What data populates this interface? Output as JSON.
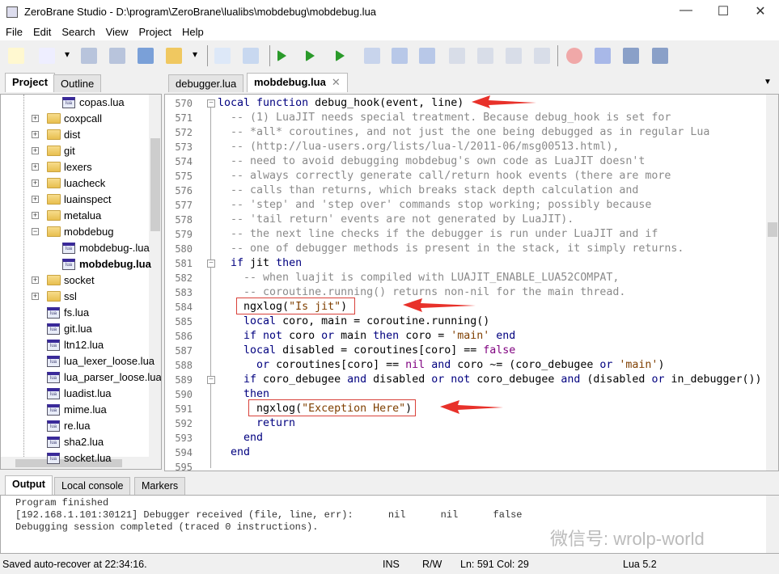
{
  "window": {
    "title": "ZeroBrane Studio - D:\\program\\ZeroBrane\\lualibs\\mobdebug\\mobdebug.lua",
    "minimize": "—",
    "maximize": "☐",
    "close": "✕"
  },
  "menu": [
    "File",
    "Edit",
    "Search",
    "View",
    "Project",
    "Help"
  ],
  "toolbar": [
    "new-file",
    "open-file",
    "save",
    "save-all",
    "project-directory",
    "choose-project-directory",
    "find",
    "find-in-files",
    "start-debugging",
    "run",
    "run-as-scratchpad",
    "stop",
    "continue",
    "pause",
    "step-into",
    "step-over",
    "step-out",
    "run-to-cursor",
    "toggle-breakpoint",
    "toggle-bookmark",
    "stack-window",
    "watch-window"
  ],
  "left_tabs": [
    "Project",
    "Outline"
  ],
  "tree": [
    {
      "label": "copas.lua",
      "type": "file",
      "level": 2
    },
    {
      "label": "coxpcall",
      "type": "folder"
    },
    {
      "label": "dist",
      "type": "folder"
    },
    {
      "label": "git",
      "type": "folder"
    },
    {
      "label": "lexers",
      "type": "folder"
    },
    {
      "label": "luacheck",
      "type": "folder"
    },
    {
      "label": "luainspect",
      "type": "folder"
    },
    {
      "label": "metalua",
      "type": "folder"
    },
    {
      "label": "mobdebug",
      "type": "folder",
      "expanded": true
    },
    {
      "label": "mobdebug-.lua",
      "type": "file",
      "level": 2
    },
    {
      "label": "mobdebug.lua",
      "type": "file",
      "level": 2,
      "bold": true
    },
    {
      "label": "socket",
      "type": "folder"
    },
    {
      "label": "ssl",
      "type": "folder"
    },
    {
      "label": "fs.lua",
      "type": "file"
    },
    {
      "label": "git.lua",
      "type": "file"
    },
    {
      "label": "ltn12.lua",
      "type": "file"
    },
    {
      "label": "lua_lexer_loose.lua",
      "type": "file"
    },
    {
      "label": "lua_parser_loose.lua",
      "type": "file"
    },
    {
      "label": "luadist.lua",
      "type": "file"
    },
    {
      "label": "mime.lua",
      "type": "file"
    },
    {
      "label": "re.lua",
      "type": "file"
    },
    {
      "label": "sha2.lua",
      "type": "file"
    },
    {
      "label": "socket.lua",
      "type": "file"
    }
  ],
  "editor_tabs": [
    {
      "label": "debugger.lua"
    },
    {
      "label": "mobdebug.lua",
      "active": true,
      "close": "✕"
    }
  ],
  "code": [
    {
      "n": "570",
      "fold": "−",
      "t": [
        [
          "k",
          "local function "
        ],
        [
          "p",
          "debug_hook(event, line)"
        ]
      ]
    },
    {
      "n": "571",
      "t": [
        [
          "c",
          "  -- (1) LuaJIT needs special treatment. Because debug_hook is set for"
        ]
      ]
    },
    {
      "n": "572",
      "t": [
        [
          "c",
          "  -- *all* coroutines, and not just the one being debugged as in regular Lua"
        ]
      ]
    },
    {
      "n": "573",
      "t": [
        [
          "c",
          "  -- (http://lua-users.org/lists/lua-l/2011-06/msg00513.html),"
        ]
      ]
    },
    {
      "n": "574",
      "t": [
        [
          "c",
          "  -- need to avoid debugging mobdebug's own code as LuaJIT doesn't"
        ]
      ]
    },
    {
      "n": "575",
      "t": [
        [
          "c",
          "  -- always correctly generate call/return hook events (there are more"
        ]
      ]
    },
    {
      "n": "576",
      "t": [
        [
          "c",
          "  -- calls than returns, which breaks stack depth calculation and"
        ]
      ]
    },
    {
      "n": "577",
      "t": [
        [
          "c",
          "  -- 'step' and 'step over' commands stop working; possibly because"
        ]
      ]
    },
    {
      "n": "578",
      "t": [
        [
          "c",
          "  -- 'tail return' events are not generated by LuaJIT)."
        ]
      ]
    },
    {
      "n": "579",
      "t": [
        [
          "c",
          "  -- the next line checks if the debugger is run under LuaJIT and if"
        ]
      ]
    },
    {
      "n": "580",
      "t": [
        [
          "c",
          "  -- one of debugger methods is present in the stack, it simply returns."
        ]
      ]
    },
    {
      "n": "581",
      "fold": "−",
      "t": [
        [
          "k",
          "  if "
        ],
        [
          "p",
          "jit "
        ],
        [
          "k",
          "then"
        ]
      ]
    },
    {
      "n": "582",
      "t": [
        [
          "c",
          "    -- when luajit is compiled with LUAJIT_ENABLE_LUA52COMPAT,"
        ]
      ]
    },
    {
      "n": "583",
      "t": [
        [
          "c",
          "    -- coroutine.running() returns non-nil for the main thread."
        ]
      ]
    },
    {
      "n": "584",
      "t": [
        [
          "p",
          "    ngxlog("
        ],
        [
          "s",
          "\"Is jit\""
        ],
        [
          "p",
          ")"
        ]
      ]
    },
    {
      "n": "585",
      "t": [
        [
          "k",
          "    local "
        ],
        [
          "p",
          "coro, main = coroutine.running()"
        ]
      ]
    },
    {
      "n": "586",
      "t": [
        [
          "k",
          "    if not "
        ],
        [
          "p",
          "coro "
        ],
        [
          "k",
          "or "
        ],
        [
          "p",
          "main "
        ],
        [
          "k",
          "then "
        ],
        [
          "p",
          "coro = "
        ],
        [
          "s",
          "'main'"
        ],
        [
          "k",
          " end"
        ]
      ]
    },
    {
      "n": "587",
      "t": [
        [
          "k",
          "    local "
        ],
        [
          "p",
          "disabled = coroutines[coro] == "
        ],
        [
          "n",
          "false"
        ]
      ]
    },
    {
      "n": "588",
      "t": [
        [
          "k",
          "      or "
        ],
        [
          "p",
          "coroutines[coro] == "
        ],
        [
          "n",
          "nil "
        ],
        [
          "k",
          "and "
        ],
        [
          "p",
          "coro ~= (coro_debugee "
        ],
        [
          "k",
          "or "
        ],
        [
          "s",
          "'main'"
        ],
        [
          "p",
          ")"
        ]
      ]
    },
    {
      "n": "589",
      "fold": "−",
      "t": [
        [
          "k",
          "    if "
        ],
        [
          "p",
          "coro_debugee "
        ],
        [
          "k",
          "and "
        ],
        [
          "p",
          "disabled "
        ],
        [
          "k",
          "or not "
        ],
        [
          "p",
          "coro_debugee "
        ],
        [
          "k",
          "and "
        ],
        [
          "p",
          "(disabled "
        ],
        [
          "k",
          "or "
        ],
        [
          "p",
          "in_debugger())"
        ]
      ]
    },
    {
      "n": "590",
      "t": [
        [
          "k",
          "    then"
        ]
      ]
    },
    {
      "n": "591",
      "t": [
        [
          "p",
          "      ngxlog("
        ],
        [
          "s",
          "\"Exception Here\""
        ],
        [
          "p",
          ")"
        ]
      ]
    },
    {
      "n": "592",
      "t": [
        [
          "k",
          "      return"
        ]
      ]
    },
    {
      "n": "593",
      "t": [
        [
          "k",
          "    end"
        ]
      ]
    },
    {
      "n": "594",
      "t": [
        [
          "k",
          "  end"
        ]
      ]
    },
    {
      "n": "595",
      "t": [
        [
          "p",
          ""
        ]
      ]
    }
  ],
  "output_tabs": [
    "Output",
    "Local console",
    "Markers"
  ],
  "output_lines": [
    "Program finished",
    "[192.168.1.101:30121] Debugger received (file, line, err):      nil      nil      false",
    "Debugging session completed (traced 0 instructions)."
  ],
  "watermark": "微信号: wrolp-world",
  "status": {
    "message": "Saved auto-recover at 22:34:16.",
    "mode": "INS",
    "access": "R/W",
    "position": "Ln: 591 Col: 29",
    "interpreter": "Lua 5.2"
  },
  "colors": {
    "keyword": "#00007f",
    "comment": "#8a8a8a",
    "string": "#7f3f00",
    "constant": "#7f007f",
    "annotation": "#e8312a"
  }
}
